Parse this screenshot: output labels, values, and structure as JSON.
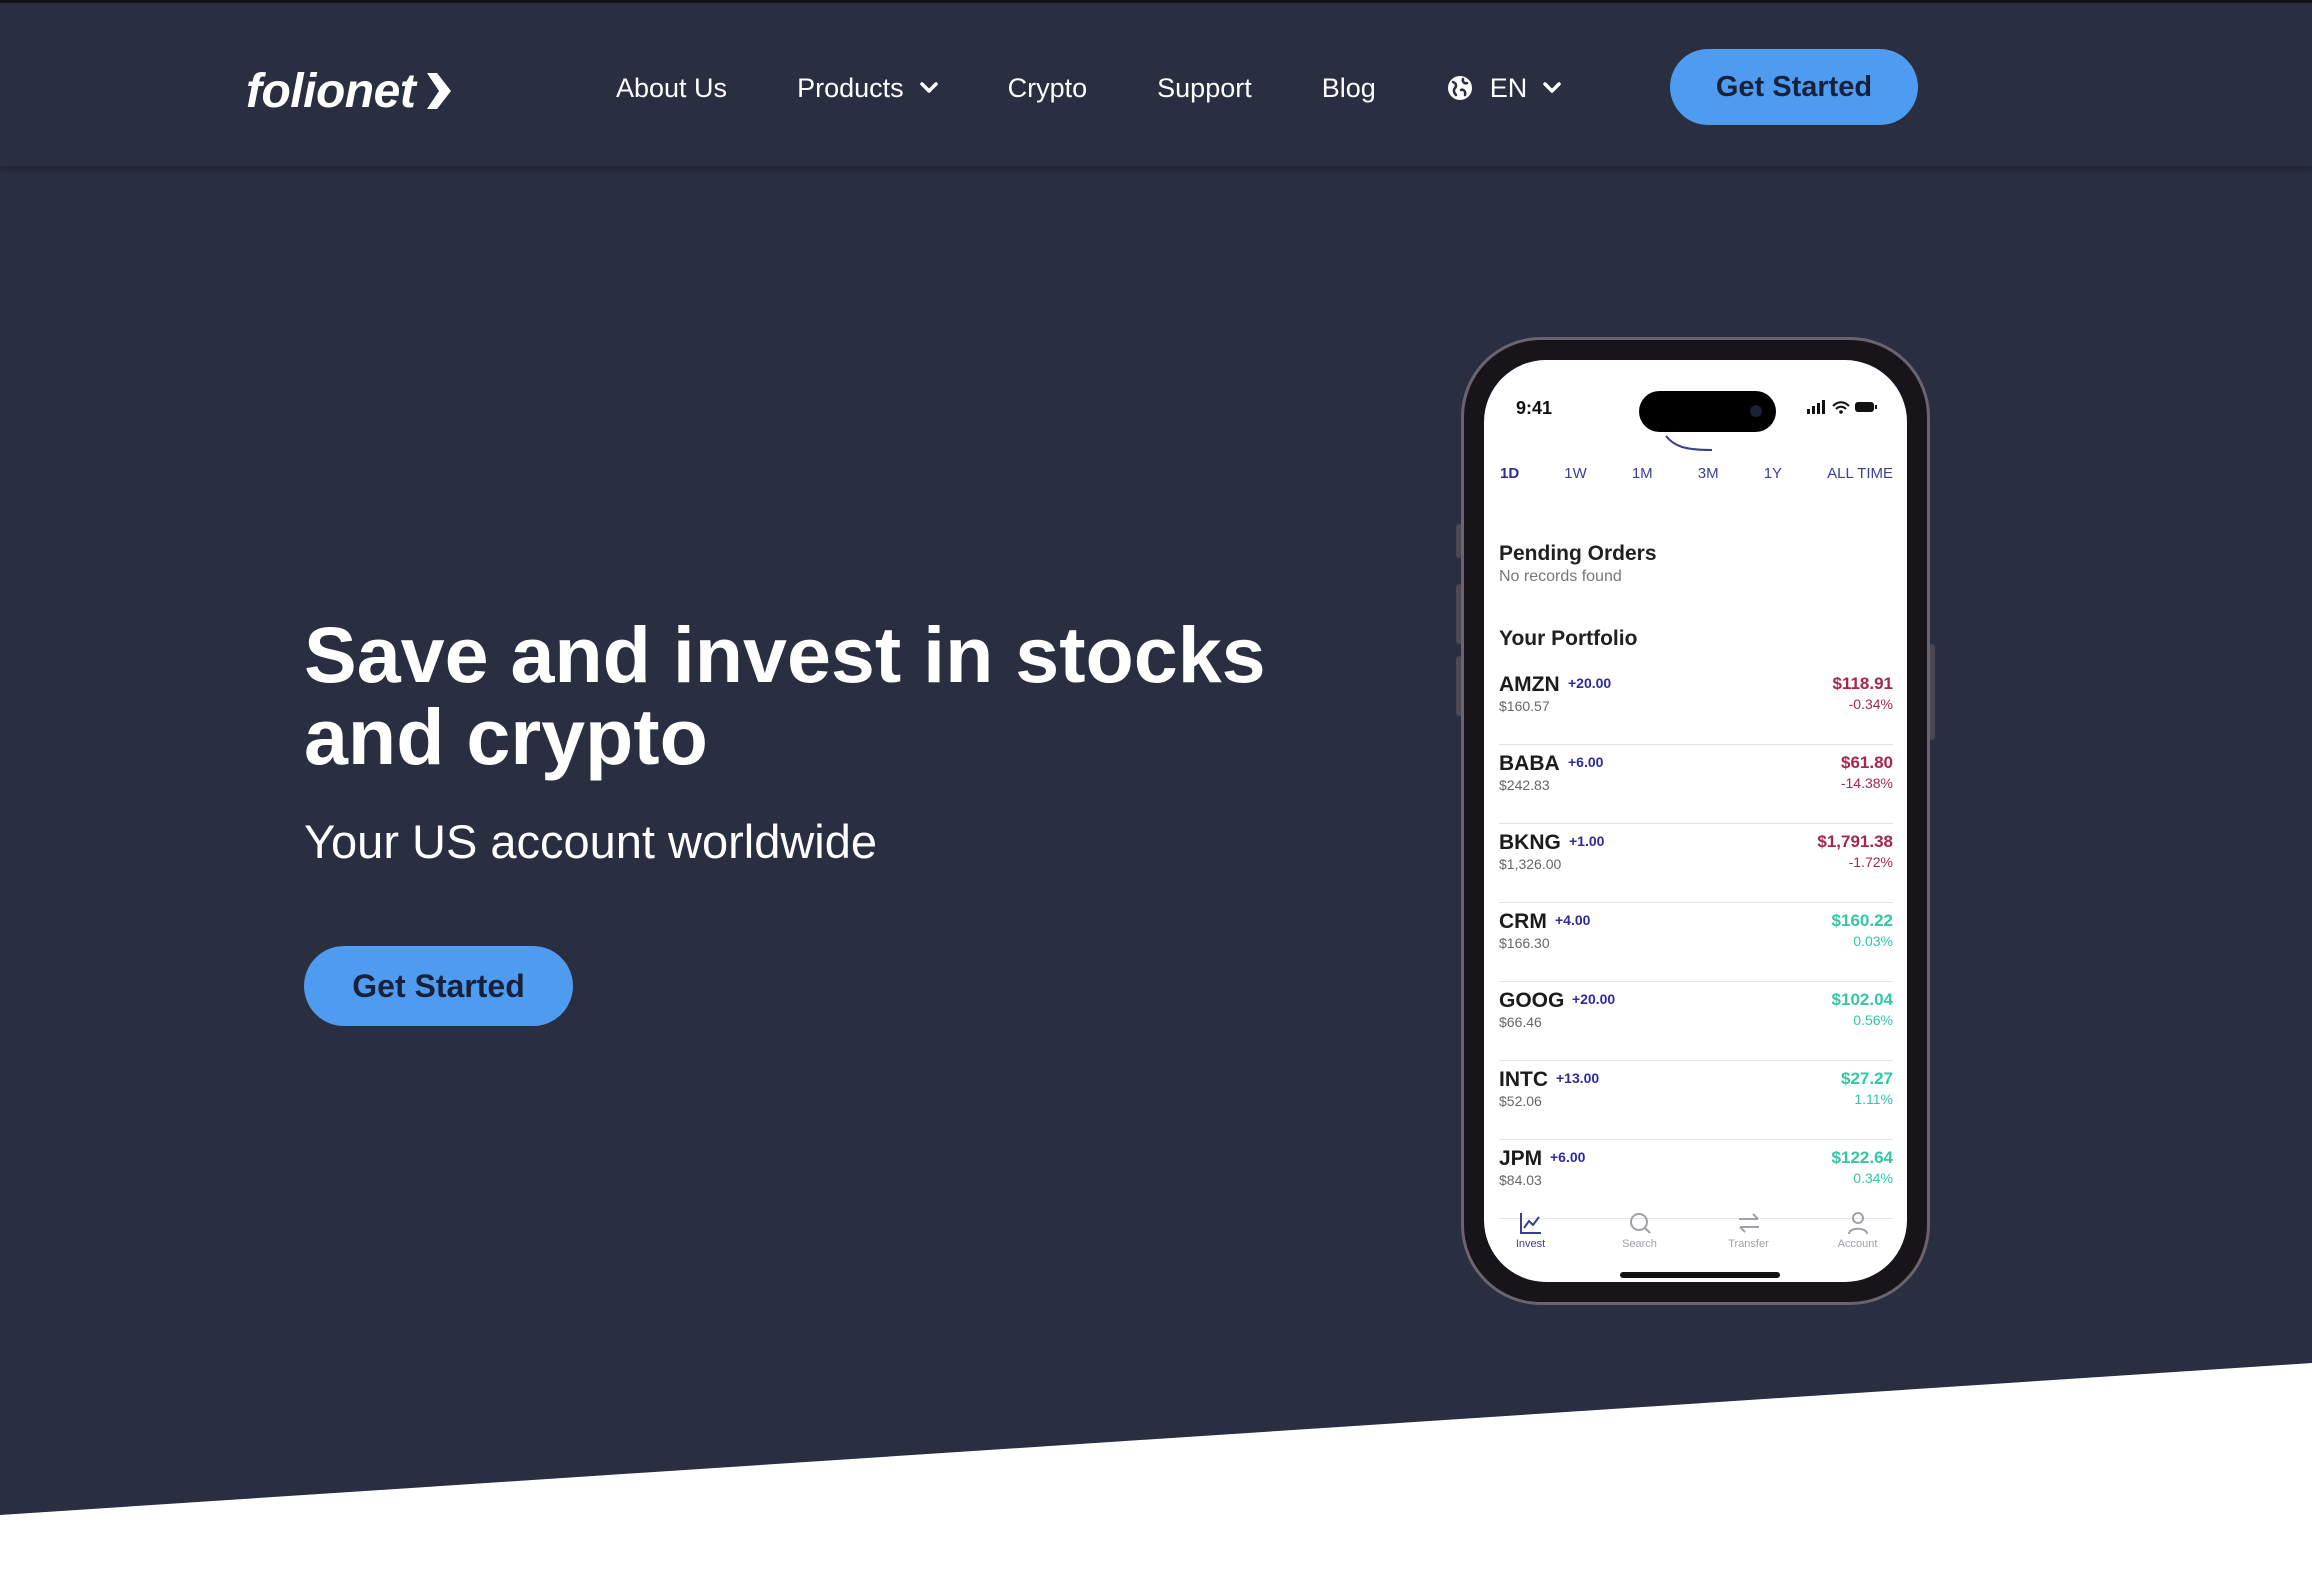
{
  "brand": {
    "name": "folionet"
  },
  "nav": {
    "items": [
      {
        "label": "About Us"
      },
      {
        "label": "Products"
      },
      {
        "label": "Crypto"
      },
      {
        "label": "Support"
      },
      {
        "label": "Blog"
      }
    ],
    "language": "EN",
    "cta_label": "Get Started"
  },
  "hero": {
    "headline": "Save and invest in stocks and crypto",
    "subheadline": "Your US account worldwide",
    "cta_label": "Get Started"
  },
  "phone": {
    "status_time": "9:41",
    "range_tabs": [
      "1D",
      "1W",
      "1M",
      "3M",
      "1Y",
      "ALL TIME"
    ],
    "active_range": "1D",
    "pending": {
      "title": "Pending Orders",
      "empty_text": "No records found"
    },
    "portfolio_title": "Your Portfolio",
    "holdings": [
      {
        "symbol": "AMZN",
        "change": "+20.00",
        "cost": "$160.57",
        "price": "$118.91",
        "percent": "-0.34%",
        "trend": "down"
      },
      {
        "symbol": "BABA",
        "change": "+6.00",
        "cost": "$242.83",
        "price": "$61.80",
        "percent": "-14.38%",
        "trend": "down"
      },
      {
        "symbol": "BKNG",
        "change": "+1.00",
        "cost": "$1,326.00",
        "price": "$1,791.38",
        "percent": "-1.72%",
        "trend": "down"
      },
      {
        "symbol": "CRM",
        "change": "+4.00",
        "cost": "$166.30",
        "price": "$160.22",
        "percent": "0.03%",
        "trend": "up"
      },
      {
        "symbol": "GOOG",
        "change": "+20.00",
        "cost": "$66.46",
        "price": "$102.04",
        "percent": "0.56%",
        "trend": "up"
      },
      {
        "symbol": "INTC",
        "change": "+13.00",
        "cost": "$52.06",
        "price": "$27.27",
        "percent": "1.11%",
        "trend": "up"
      },
      {
        "symbol": "JPM",
        "change": "+6.00",
        "cost": "$84.03",
        "price": "$122.64",
        "percent": "0.34%",
        "trend": "up"
      }
    ],
    "tabbar": [
      {
        "label": "Invest",
        "icon": "chart-icon",
        "active": true
      },
      {
        "label": "Search",
        "icon": "search-icon",
        "active": false
      },
      {
        "label": "Transfer",
        "icon": "transfer-icon",
        "active": false
      },
      {
        "label": "Account",
        "icon": "account-icon",
        "active": false
      }
    ]
  },
  "colors": {
    "background": "#292e40",
    "accent": "#4f9bef",
    "negative": "#a8264e",
    "positive": "#35c6a5",
    "change": "#2f2a9a"
  }
}
